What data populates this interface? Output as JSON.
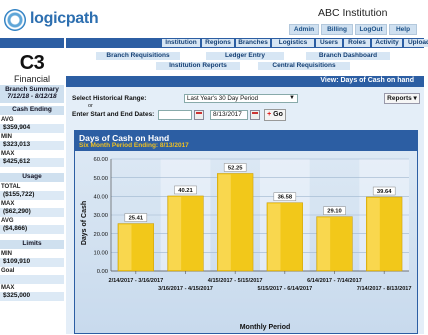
{
  "header": {
    "logo_text": "logicpath",
    "institution": "ABC Institution",
    "links": [
      "Admin",
      "Billing",
      "LogOut",
      "Help"
    ]
  },
  "nav": {
    "items": [
      "Institution",
      "Regions",
      "Branches",
      "Logistics",
      "Users",
      "Roles",
      "Activity",
      "Upload"
    ]
  },
  "subnav": {
    "items": [
      "Branch Requisitions",
      "Ledger Entry",
      "Branch Dashboard",
      "Institution Reports",
      "Central Requisitions"
    ]
  },
  "sidebar": {
    "title": "C3",
    "subtitle": "Financial",
    "summary_title": "Branch Summary",
    "summary_range": "7/12/18 - 8/12/18",
    "cash_ending": {
      "heading": "Cash Ending",
      "avg_label": "AVG",
      "avg_value": "$359,904",
      "min_label": "MIN",
      "min_value": "$323,013",
      "max_label": "MAX",
      "max_value": "$425,612"
    },
    "usage": {
      "heading": "Usage",
      "total_label": "TOTAL",
      "total_value": "($155,722)",
      "max_label": "MAX",
      "max_value": "($62,290)",
      "avg_label": "AVG",
      "avg_value": "($4,866)"
    },
    "limits": {
      "heading": "Limits",
      "min_label": "MIN",
      "min_value": "$109,910",
      "goal_label": "Goal",
      "max_label": "MAX",
      "max_value": "$325,000"
    }
  },
  "main": {
    "view_title": "View: Days of Cash on hand",
    "historical_label": "Select Historical Range:",
    "historical_value": "Last Year's 30 Day Period",
    "or_text": "or",
    "dates_label": "Enter Start and End Dates:",
    "start_date": "",
    "end_date": "8/13/2017",
    "go_label": "Go",
    "go_plus": "+",
    "reports_label": "Reports"
  },
  "chart_data": {
    "type": "bar",
    "title": "Days of Cash on Hand",
    "subtitle": "Six Month Period Ending: 8/13/2017",
    "xlabel": "Monthly Period",
    "ylabel": "Days of Cash",
    "ylim": [
      0,
      60
    ],
    "yticks": [
      "0.00",
      "10.00",
      "20.00",
      "30.00",
      "40.00",
      "50.00",
      "60.00"
    ],
    "categories": [
      "2/14/2017 - 3/16/2017",
      "3/16/2017 - 4/15/2017",
      "4/15/2017 - 5/15/2017",
      "5/15/2017 - 6/14/2017",
      "6/14/2017 - 7/14/2017",
      "7/14/2017 - 8/13/2017"
    ],
    "values": [
      25.41,
      40.21,
      52.25,
      36.58,
      29.1,
      39.64
    ],
    "value_labels": [
      "25.41",
      "40.21",
      "52.25",
      "36.58",
      "29.10",
      "39.64"
    ],
    "bar_color": "#f2c81a",
    "grid": true
  }
}
